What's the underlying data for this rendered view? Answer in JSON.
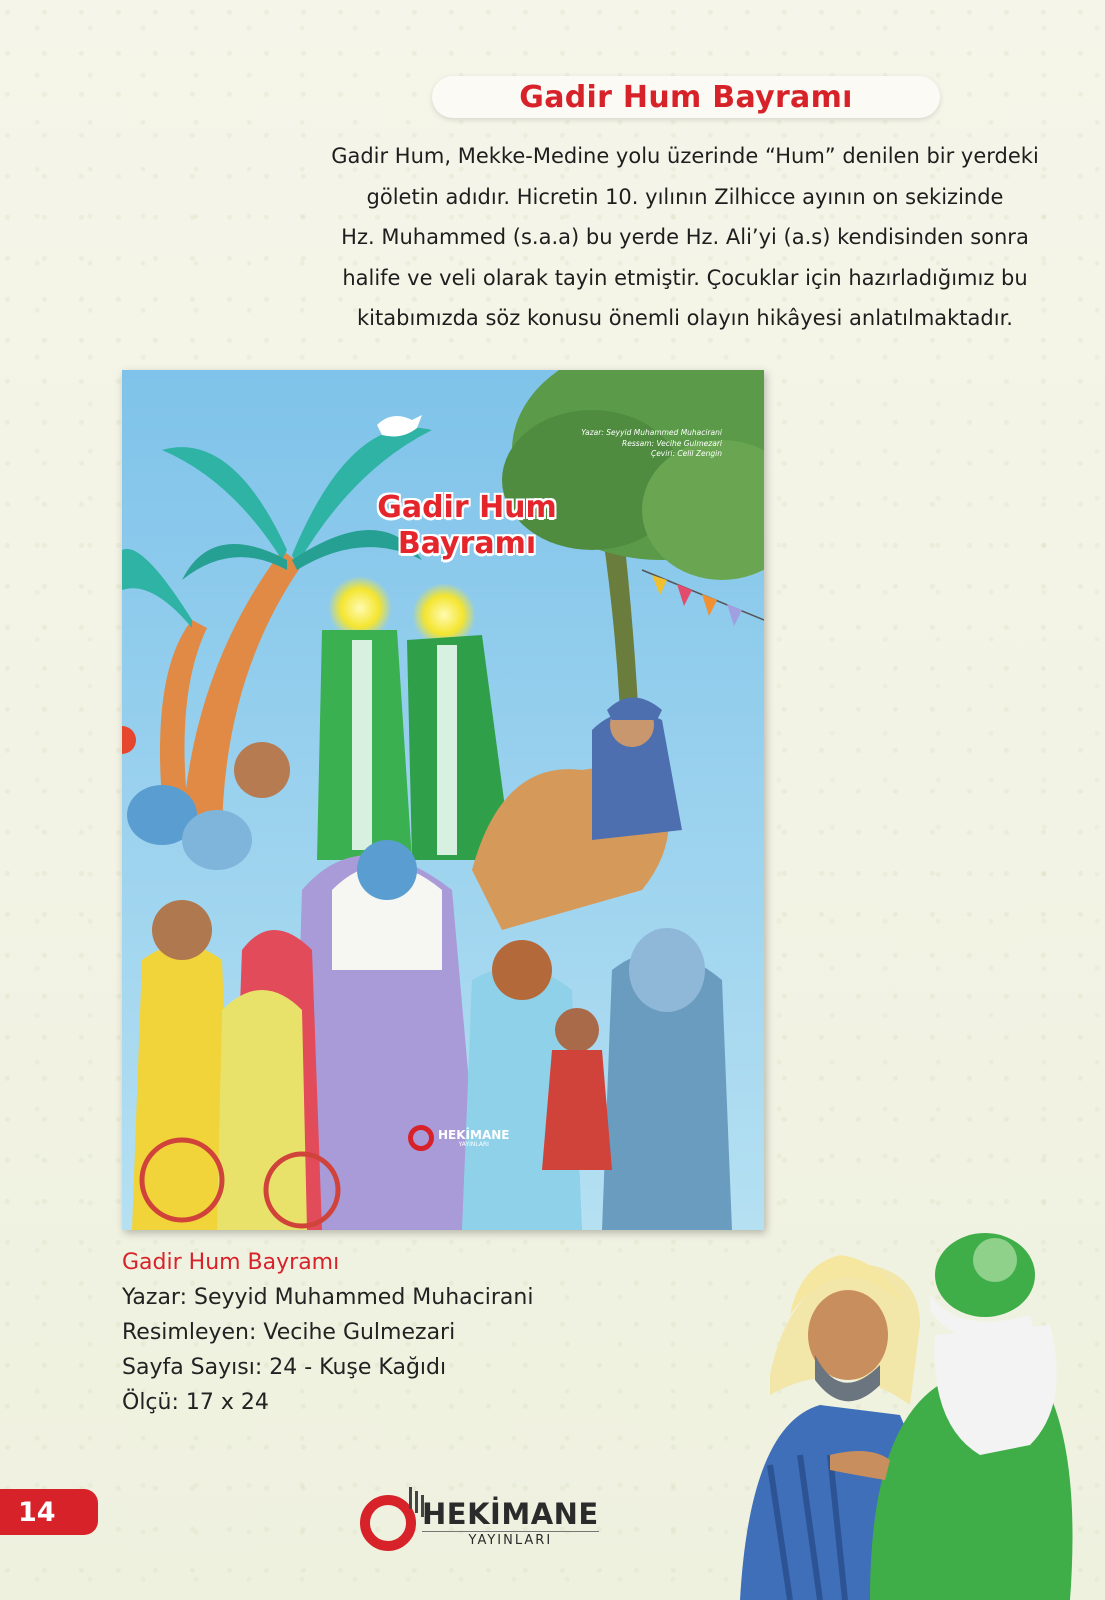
{
  "header": {
    "title": "Gadir Hum Bayramı"
  },
  "intro": {
    "lines": [
      "Gadir Hum, Mekke-Medine yolu üzerinde “Hum” denilen bir yerdeki",
      "göletin adıdır. Hicretin 10. yılının Zilhicce ayının on sekizinde",
      "Hz. Muhammed (s.a.a) bu yerde Hz. Ali’yi (a.s) kendisinden sonra",
      "halife ve veli olarak tayin etmiştir. Çocuklar için hazırladığımız bu",
      "kitabımızda söz konusu önemli olayın hikâyesi anlatılmaktadır."
    ]
  },
  "cover": {
    "title_line1": "Gadir Hum",
    "title_line2": "Bayramı",
    "credit_author": "Yazar: Seyyid Muhammed Muhacirani",
    "credit_illustrator": "Ressam: Vecihe Gulmezari",
    "credit_translator": "Çeviri: Celil Zengin",
    "logo_text": "HEKİMANE",
    "logo_sub": "YAYINLARI"
  },
  "book_info": {
    "name": "Gadir Hum Bayramı",
    "author": "Yazar: Seyyid Muhammed Muhacirani",
    "illustrator": "Resimleyen: Vecihe Gulmezari",
    "pages": "Sayfa Sayısı: 24 - Kuşe Kağıdı",
    "size": "Ölçü: 17 x 24"
  },
  "footer": {
    "page_number": "14",
    "brand": "HEKİMANE",
    "brand_sub": "YAYINLARI"
  },
  "colors": {
    "accent_red": "#d8222a",
    "sky_blue": "#8ecbe9",
    "palm_green": "#2eb3a4",
    "robe_green": "#3bb050"
  }
}
